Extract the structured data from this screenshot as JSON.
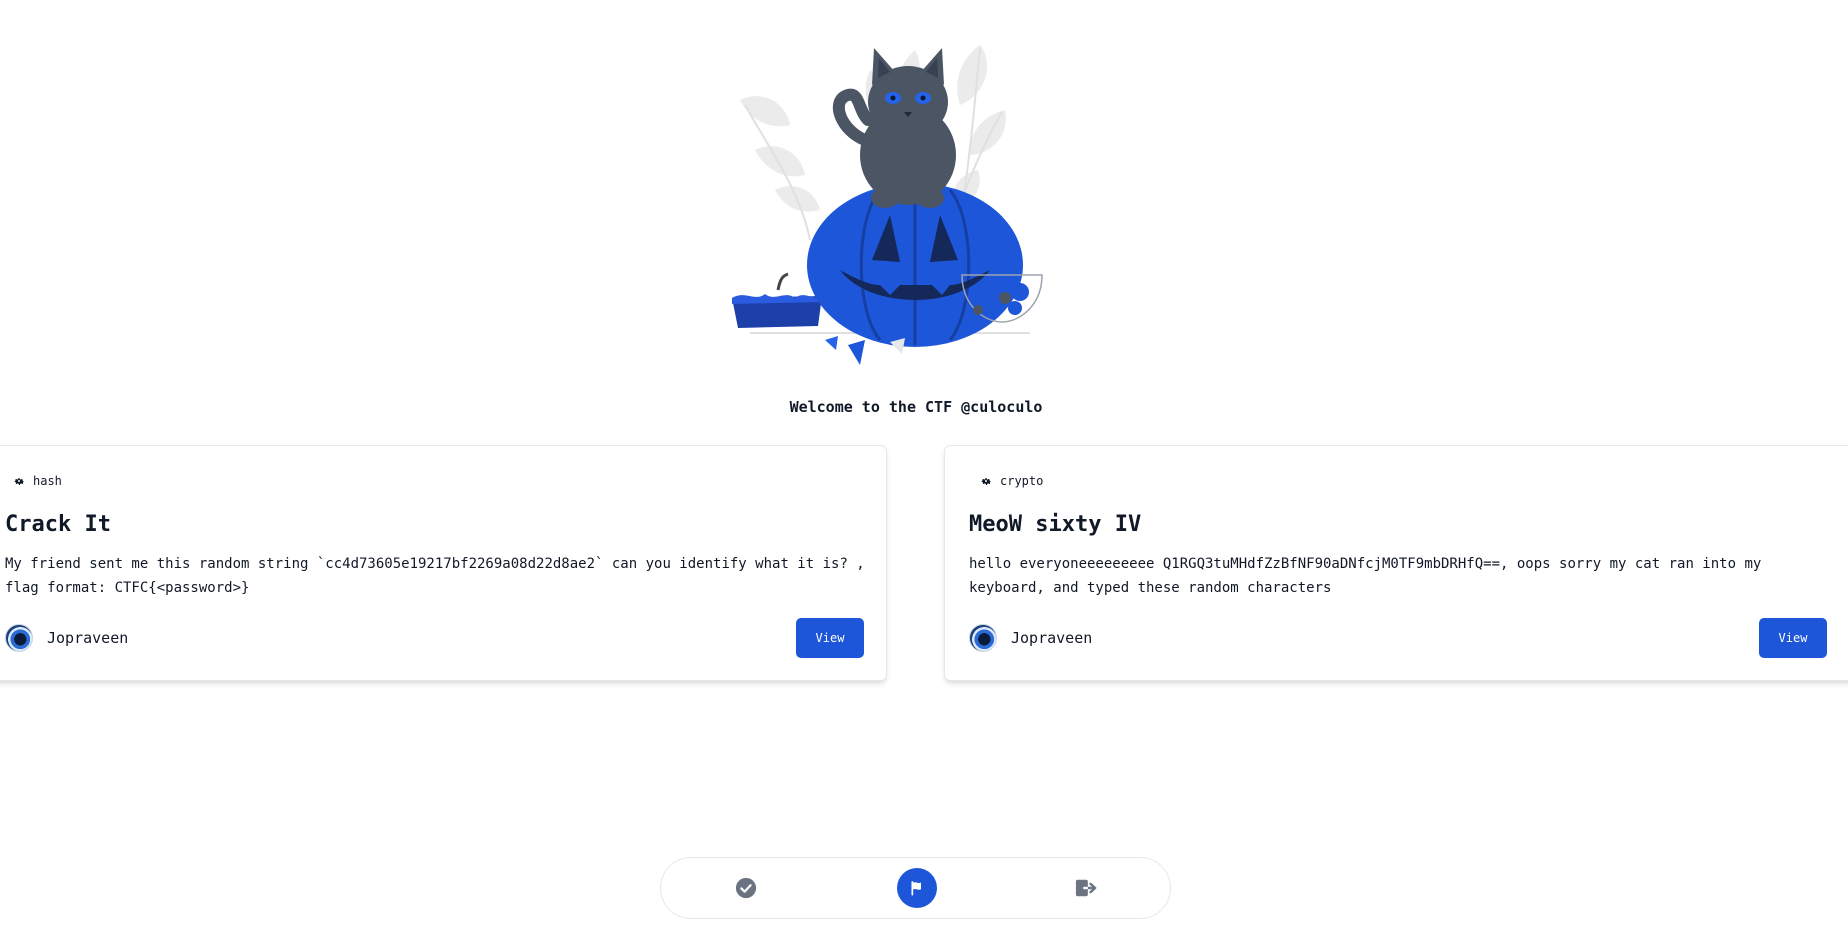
{
  "welcome": {
    "text": "Welcome to the CTF @culoculo"
  },
  "colors": {
    "accent": "#1d56d8",
    "text": "#111827",
    "border": "#e5e7eb",
    "muted_icon": "#6b7280"
  },
  "challenges": [
    {
      "category": "hash",
      "category_icon": "gear-icon",
      "title": "Crack It",
      "description": "My friend sent me this random string `cc4d73605e19217bf2269a08d22d8ae2` can you identify what it is? , flag format: CTFC{<password>}",
      "author": "Jopraveen",
      "view_label": "View"
    },
    {
      "category": "crypto",
      "category_icon": "gear-icon",
      "title": "MeoW sixty IV",
      "description": "hello everyoneeeeeeeee Q1RGQ3tuMHdfZzBfNF90aDNfcjM0TF9mbDRHfQ==, oops sorry my cat ran into my keyboard, and typed these random characters",
      "author": "Jopraveen",
      "view_label": "View"
    }
  ],
  "bottom_nav": {
    "items": [
      {
        "icon": "check-circle-icon",
        "active": false
      },
      {
        "icon": "flag-icon",
        "active": true
      },
      {
        "icon": "logout-icon",
        "active": false
      }
    ]
  }
}
